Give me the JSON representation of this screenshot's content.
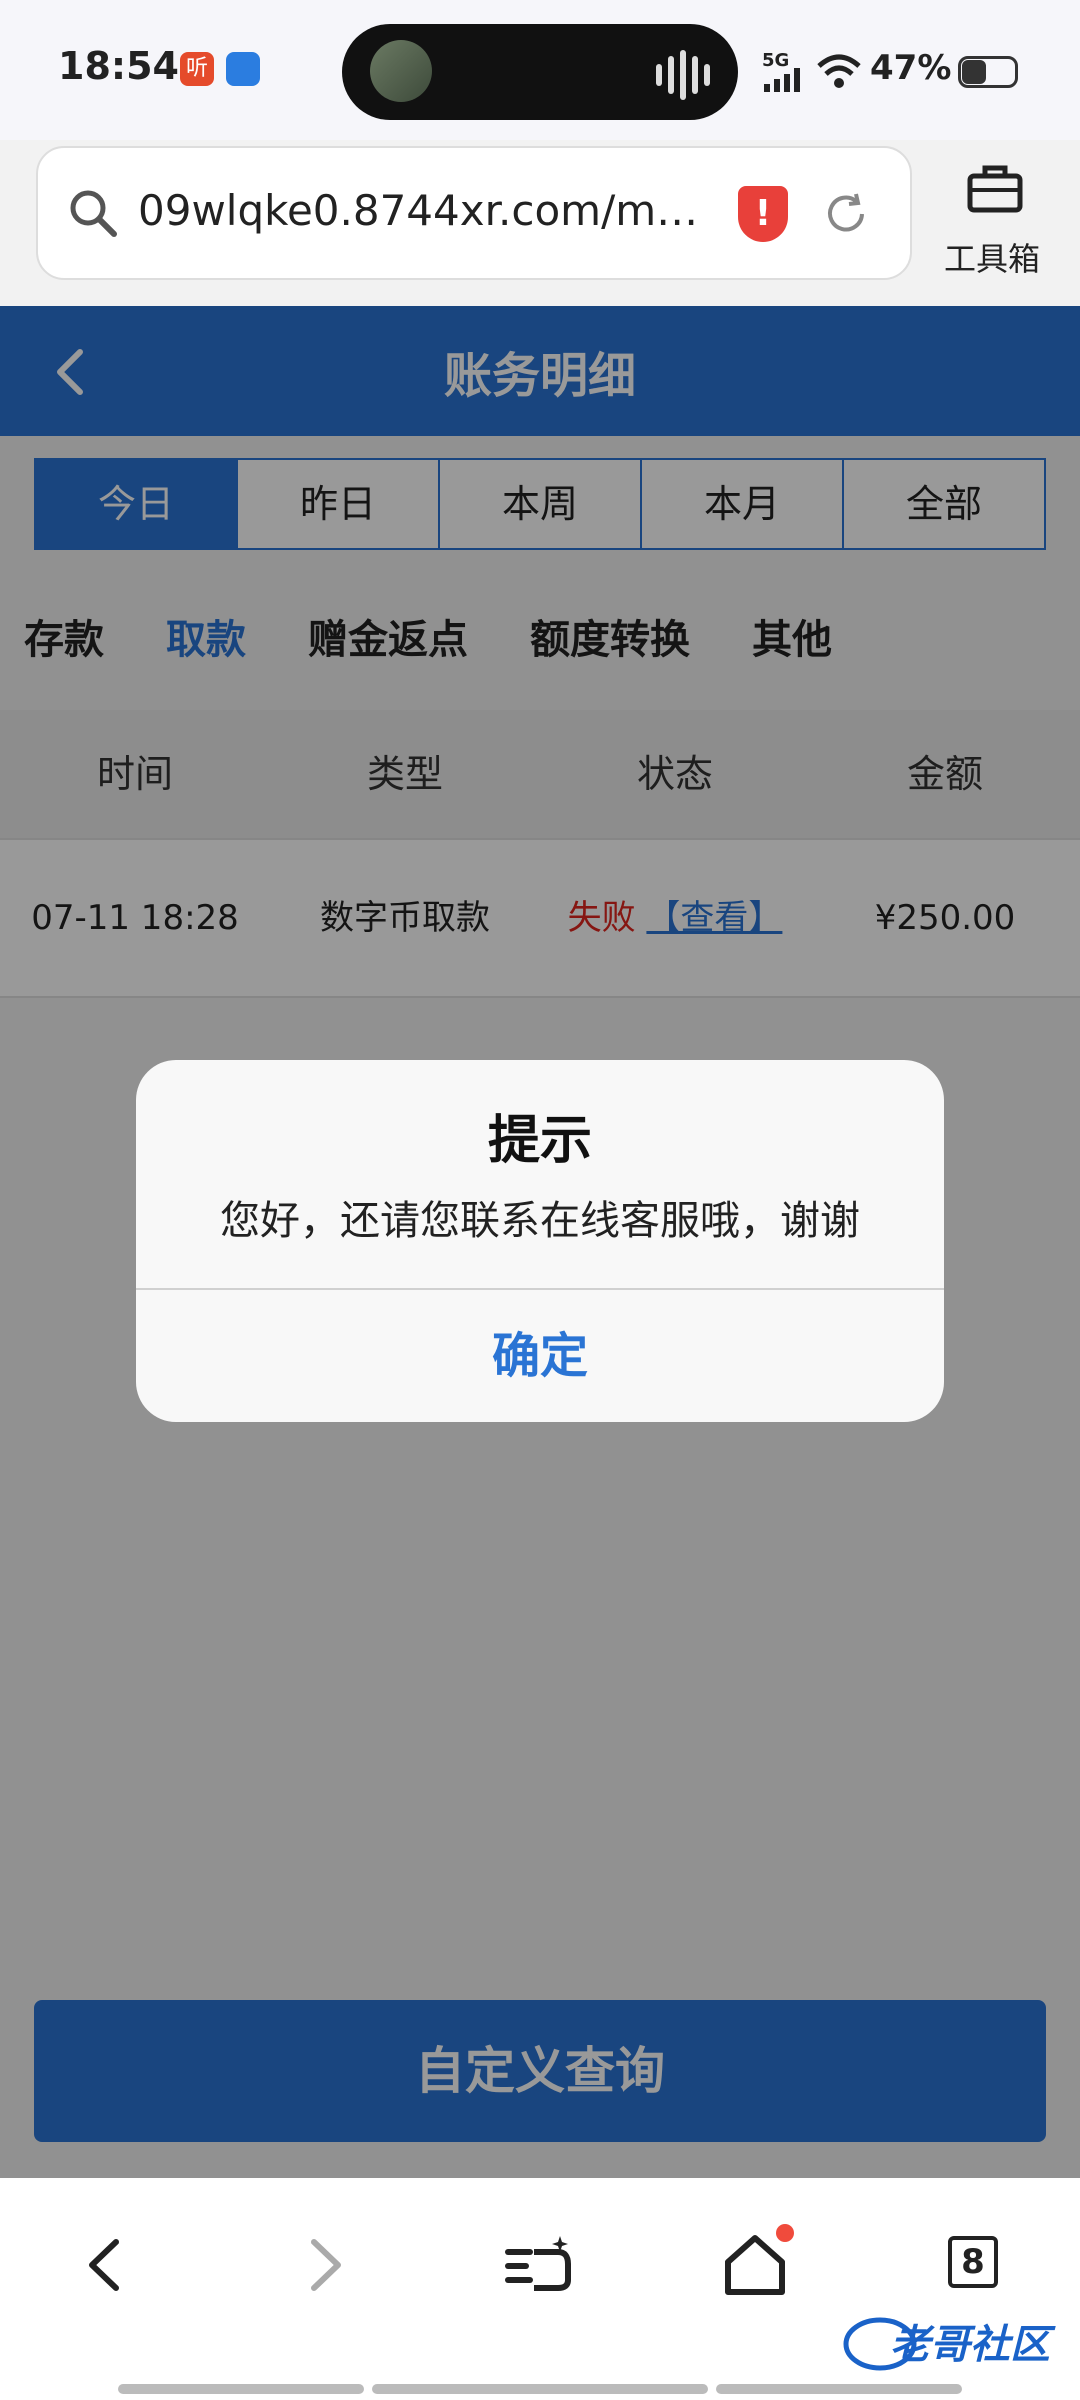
{
  "status_bar": {
    "time": "18:54",
    "app_icon_1": "听",
    "network": "5G",
    "battery_percent": "47%"
  },
  "browser": {
    "url": "09wlqke0.8744xr.com/m…",
    "security_warning": "!",
    "toolbox_label": "工具箱",
    "tab_count": "8"
  },
  "page": {
    "title": "账务明细",
    "date_tabs": [
      "今日",
      "昨日",
      "本周",
      "本月",
      "全部"
    ],
    "active_date_tab": 0,
    "categories": [
      "存款",
      "取款",
      "赠金返点",
      "额度转换",
      "其他"
    ],
    "active_category": 1,
    "table": {
      "headers": [
        "时间",
        "类型",
        "状态",
        "金额"
      ],
      "rows": [
        {
          "time": "07-11 18:28",
          "type": "数字币取款",
          "status": "失败",
          "action": "【查看】",
          "amount": "¥250.00"
        }
      ]
    },
    "custom_query_label": "自定义查询"
  },
  "dialog": {
    "title": "提示",
    "message": "您好，还请您联系在线客服哦，谢谢",
    "confirm_label": "确定"
  },
  "watermark": "老哥社区",
  "colors": {
    "accent": "#2a74d4",
    "error": "#e0261e"
  }
}
